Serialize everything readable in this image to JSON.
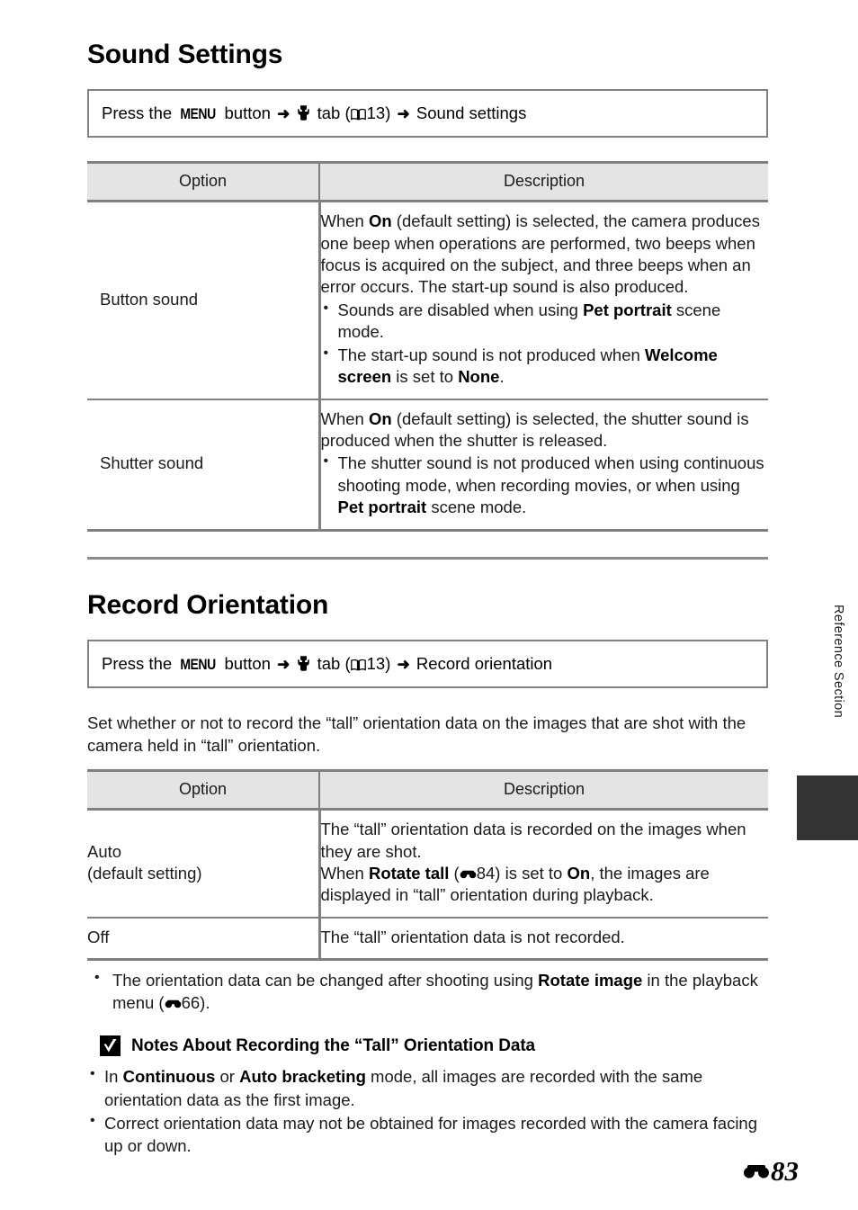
{
  "page": {
    "number_label": "83",
    "number_symbol": "reference-section-symbol",
    "side_label": "Reference Section"
  },
  "sections": [
    {
      "title": "Sound Settings",
      "menu_path": {
        "prefix": "Press the",
        "menu_button": "MENU",
        "button_word": "button",
        "arrow1": "➜",
        "tab_icon": "wrench-icon",
        "tab_word": "tab",
        "open_paren": "(",
        "book_icon": "book-icon",
        "page_ref": "13",
        "close_paren": ")",
        "arrow2": "➜",
        "destination": "Sound settings"
      },
      "table": {
        "headers": [
          "Option",
          "Description"
        ],
        "rows": [
          {
            "option": "Button sound",
            "intro": "When <b>On</b> (default setting) is selected, the camera produces one beep when operations are performed, two beeps when focus is acquired on the subject, and three beeps when an error occurs. The start-up sound is also produced.",
            "bullets": [
              "Sounds are disabled when using <b>Pet portrait</b> scene mode.",
              "The start-up sound is not produced when <b>Welcome screen</b> is set to <b>None</b>."
            ]
          },
          {
            "option": "Shutter sound",
            "intro": "When <b>On</b> (default setting) is selected, the shutter sound is produced when the shutter is released.",
            "bullets": [
              "The shutter sound is not produced when using continuous shooting mode, when recording movies, or when using <b>Pet portrait</b> scene mode."
            ]
          }
        ]
      }
    },
    {
      "title": "Record Orientation",
      "menu_path": {
        "prefix": "Press the",
        "menu_button": "MENU",
        "button_word": "button",
        "arrow1": "➜",
        "tab_icon": "wrench-icon",
        "tab_word": "tab",
        "open_paren": "(",
        "book_icon": "book-icon",
        "page_ref": "13",
        "close_paren": ")",
        "arrow2": "➜",
        "destination": "Record orientation"
      },
      "intro_paragraph": "Set whether or not to record the “tall” orientation data on the images that are shot with the camera held in “tall” orientation.",
      "table": {
        "headers": [
          "Option",
          "Description"
        ],
        "rows": [
          {
            "option_line1": "Auto",
            "option_line2": "(default setting)",
            "description": "The “tall” orientation data is recorded on the images when they are shot.<br>When <b>Rotate tall</b> (<span class=\"ref-icon\"><svg viewBox=\"0 0 30 16\" width=\"19\" height=\"11\"><circle cx=\"7\" cy=\"9.5\" r=\"6\" fill=\"#000\"/><circle cx=\"23\" cy=\"9.5\" r=\"6\" fill=\"#000\"/><rect x=\"5\" y=\"2\" width=\"20\" height=\"7\" rx=\"1.5\" fill=\"#000\"/></svg></span>84) is set to <b>On</b>, the images are displayed in “tall” orientation during playback."
          },
          {
            "option_line1": "Off",
            "option_line2": "",
            "description": "The “tall” orientation data is not recorded."
          }
        ]
      },
      "after_table_bullets": [
        "The orientation data can be changed after shooting using <b>Rotate image</b> in the playback menu (<span class=\"ref-icon\"><svg viewBox=\"0 0 30 16\" width=\"19\" height=\"11\"><circle cx=\"7\" cy=\"9.5\" r=\"6\" fill=\"#000\"/><circle cx=\"23\" cy=\"9.5\" r=\"6\" fill=\"#000\"/><rect x=\"5\" y=\"2\" width=\"20\" height=\"7\" rx=\"1.5\" fill=\"#000\"/></svg></span>66)."
      ],
      "notes": {
        "icon": "check-box-icon",
        "title": "Notes About Recording the “Tall” Orientation Data",
        "bullets": [
          "In <b>Continuous</b> or <b>Auto bracketing</b> mode, all images are recorded with the same orientation data as the first image.",
          "Correct orientation data may not be obtained for images recorded with the camera facing up or down."
        ]
      }
    }
  ],
  "colors": {
    "table_header_bg": "#e4e4e4",
    "table_border": "#808080",
    "side_tab": "#333333",
    "text": "#1a1a1a"
  }
}
